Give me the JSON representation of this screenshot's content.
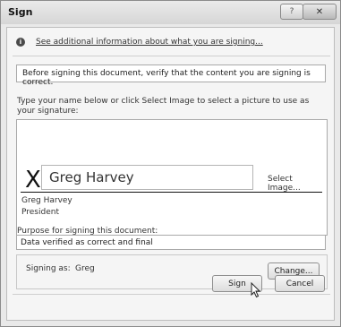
{
  "window": {
    "title": "Sign",
    "help_label": "?",
    "close_label": "✕"
  },
  "info": {
    "icon": "info-icon",
    "link_text": "See additional information about what you are signing..."
  },
  "verify_text": "Before signing this document, verify that the content you are signing is correct.",
  "signature": {
    "instructions": "Type your name below or click Select Image to select a picture to use as your signature:",
    "x_mark": "X",
    "typed_name": "Greg Harvey",
    "select_image_label": "Select Image...",
    "signer_name": "Greg Harvey",
    "signer_title": "President"
  },
  "purpose": {
    "label": "Purpose for signing this document:",
    "value": "Data verified as correct and final"
  },
  "signing_as": {
    "label": "Signing as:",
    "name": "Greg",
    "change_label": "Change..."
  },
  "buttons": {
    "sign": "Sign",
    "cancel": "Cancel"
  }
}
